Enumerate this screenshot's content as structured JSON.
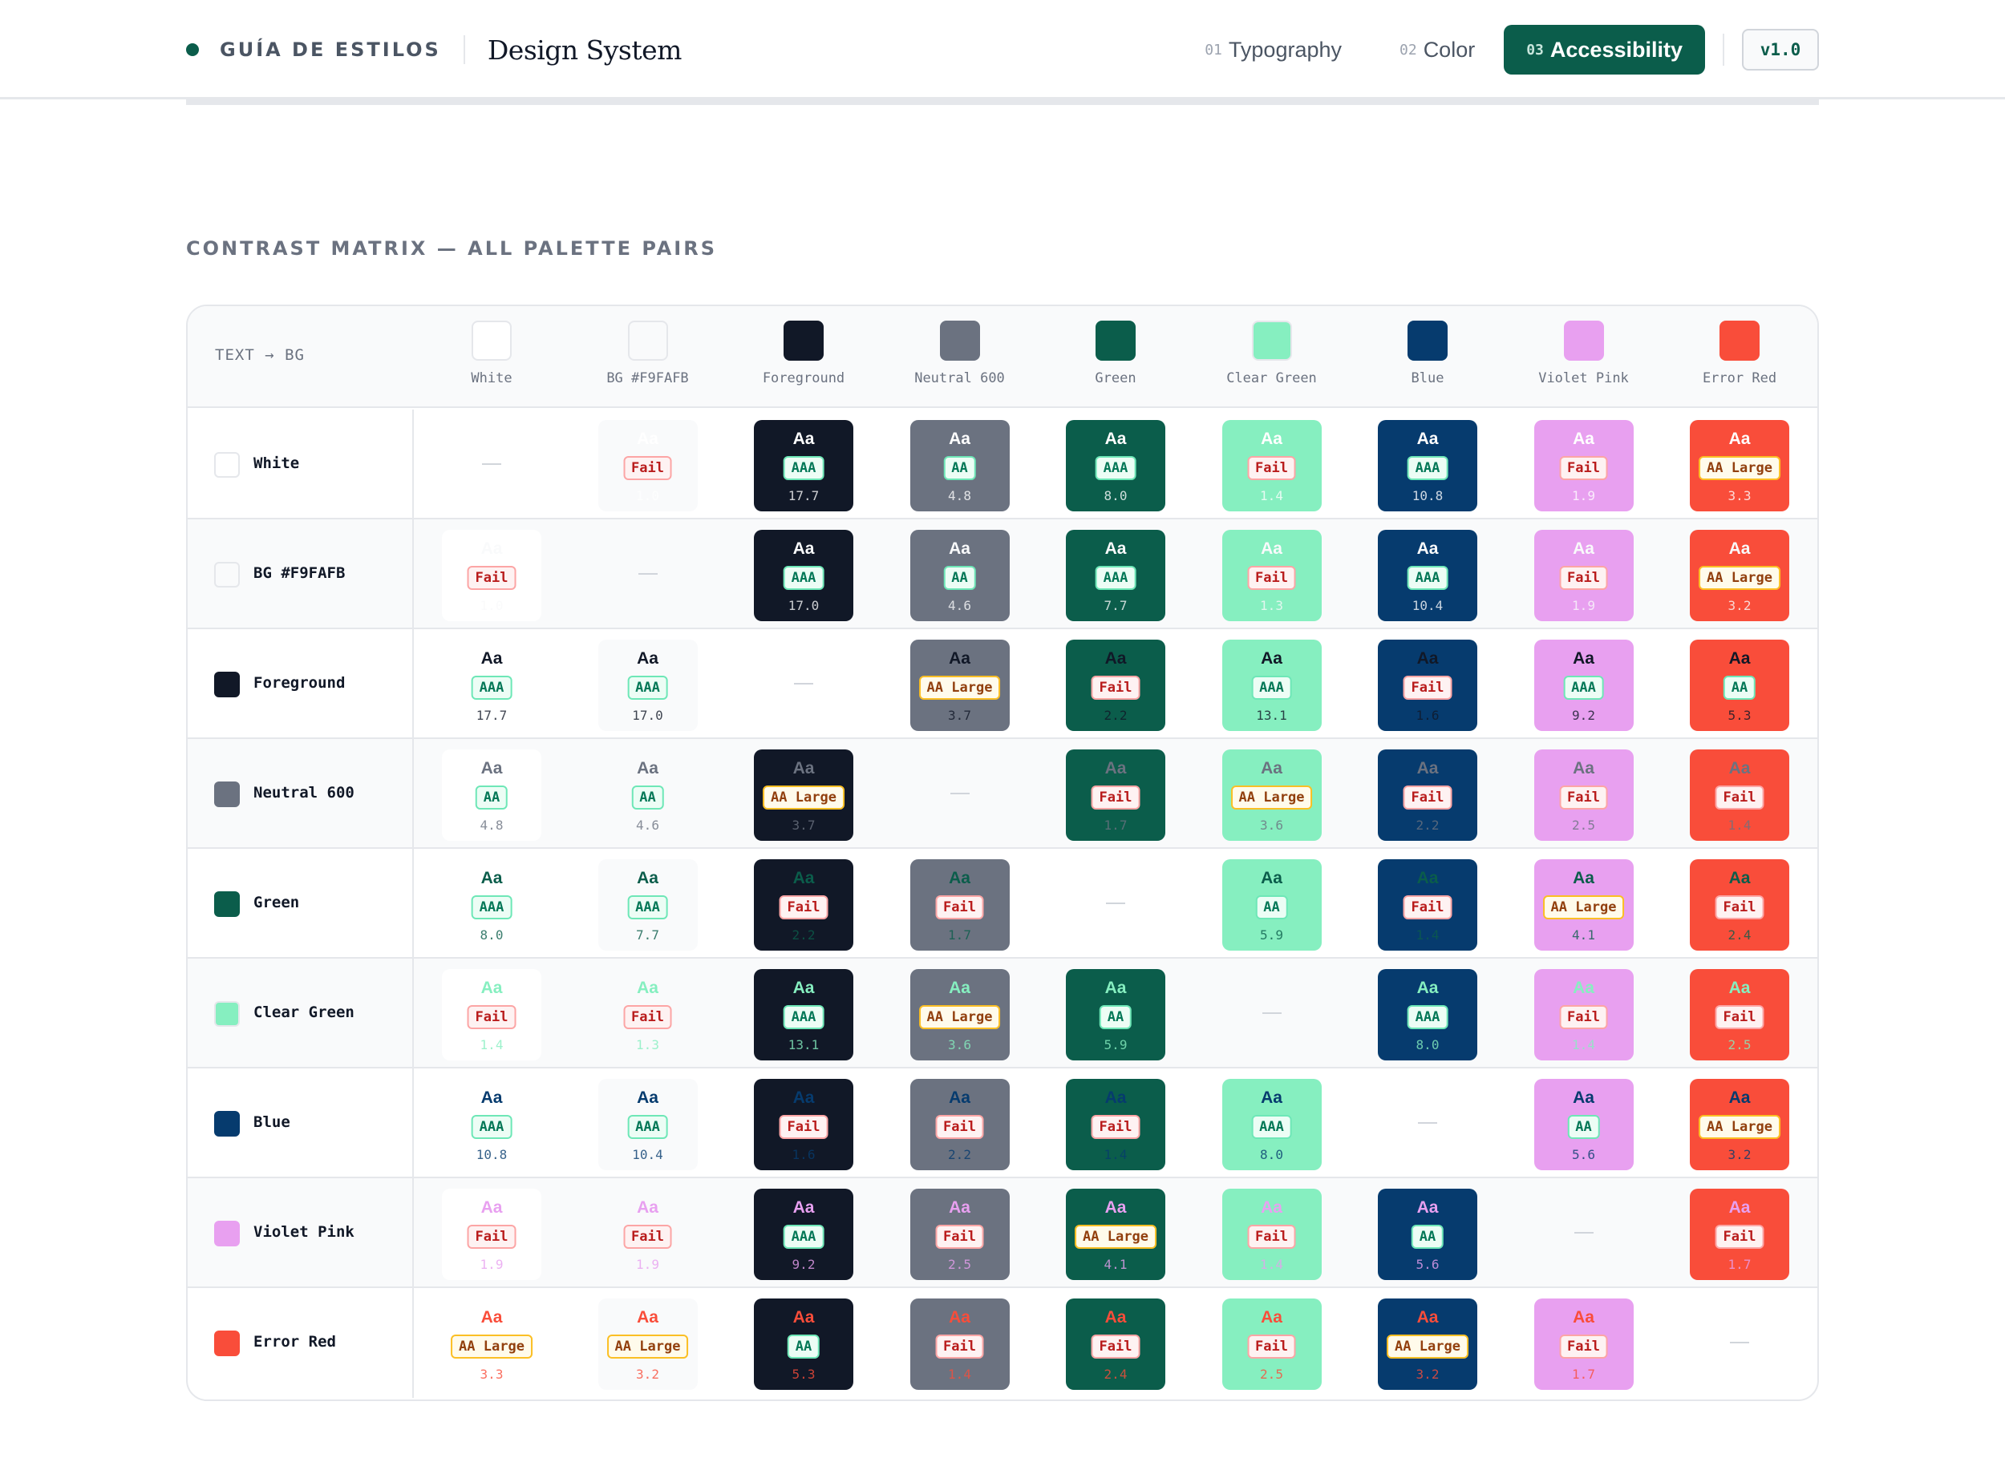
{
  "header": {
    "kicker": "GUÍA DE ESTILOS",
    "title": "Design System",
    "nav": [
      {
        "num": "01",
        "label": "Typography",
        "active": false
      },
      {
        "num": "02",
        "label": "Color",
        "active": false
      },
      {
        "num": "03",
        "label": "Accessibility",
        "active": true
      }
    ],
    "version": "v1.0"
  },
  "section_title": "CONTRAST MATRIX — ALL PALETTE PAIRS",
  "corner_label": "TEXT → BG",
  "palette": [
    {
      "name": "White",
      "hex": "#FFFFFF"
    },
    {
      "name": "BG #F9FAFB",
      "hex": "#F9FAFB"
    },
    {
      "name": "Foreground",
      "hex": "#111827"
    },
    {
      "name": "Neutral 600",
      "hex": "#6B7280"
    },
    {
      "name": "Green",
      "hex": "#0B5D4B"
    },
    {
      "name": "Clear Green",
      "hex": "#86EFC0"
    },
    {
      "name": "Blue",
      "hex": "#063B6E"
    },
    {
      "name": "Violet Pink",
      "hex": "#E8A0F0"
    },
    {
      "name": "Error Red",
      "hex": "#F94D3A"
    }
  ],
  "sample_text": "Aa",
  "empty_marker": "—",
  "matrix": [
    [
      null,
      [
        "Fail",
        "1.0"
      ],
      [
        "AAA",
        "17.7"
      ],
      [
        "AA",
        "4.8"
      ],
      [
        "AAA",
        "8.0"
      ],
      [
        "Fail",
        "1.4"
      ],
      [
        "AAA",
        "10.8"
      ],
      [
        "Fail",
        "1.9"
      ],
      [
        "AA Large",
        "3.3"
      ]
    ],
    [
      [
        "Fail",
        "1.0"
      ],
      null,
      [
        "AAA",
        "17.0"
      ],
      [
        "AA",
        "4.6"
      ],
      [
        "AAA",
        "7.7"
      ],
      [
        "Fail",
        "1.3"
      ],
      [
        "AAA",
        "10.4"
      ],
      [
        "Fail",
        "1.9"
      ],
      [
        "AA Large",
        "3.2"
      ]
    ],
    [
      [
        "AAA",
        "17.7"
      ],
      [
        "AAA",
        "17.0"
      ],
      null,
      [
        "AA Large",
        "3.7"
      ],
      [
        "Fail",
        "2.2"
      ],
      [
        "AAA",
        "13.1"
      ],
      [
        "Fail",
        "1.6"
      ],
      [
        "AAA",
        "9.2"
      ],
      [
        "AA",
        "5.3"
      ]
    ],
    [
      [
        "AA",
        "4.8"
      ],
      [
        "AA",
        "4.6"
      ],
      [
        "AA Large",
        "3.7"
      ],
      null,
      [
        "Fail",
        "1.7"
      ],
      [
        "AA Large",
        "3.6"
      ],
      [
        "Fail",
        "2.2"
      ],
      [
        "Fail",
        "2.5"
      ],
      [
        "Fail",
        "1.4"
      ]
    ],
    [
      [
        "AAA",
        "8.0"
      ],
      [
        "AAA",
        "7.7"
      ],
      [
        "Fail",
        "2.2"
      ],
      [
        "Fail",
        "1.7"
      ],
      null,
      [
        "AA",
        "5.9"
      ],
      [
        "Fail",
        "1.4"
      ],
      [
        "AA Large",
        "4.1"
      ],
      [
        "Fail",
        "2.4"
      ]
    ],
    [
      [
        "Fail",
        "1.4"
      ],
      [
        "Fail",
        "1.3"
      ],
      [
        "AAA",
        "13.1"
      ],
      [
        "AA Large",
        "3.6"
      ],
      [
        "AA",
        "5.9"
      ],
      null,
      [
        "AAA",
        "8.0"
      ],
      [
        "Fail",
        "1.4"
      ],
      [
        "Fail",
        "2.5"
      ]
    ],
    [
      [
        "AAA",
        "10.8"
      ],
      [
        "AAA",
        "10.4"
      ],
      [
        "Fail",
        "1.6"
      ],
      [
        "Fail",
        "2.2"
      ],
      [
        "Fail",
        "1.4"
      ],
      [
        "AAA",
        "8.0"
      ],
      null,
      [
        "AA",
        "5.6"
      ],
      [
        "AA Large",
        "3.2"
      ]
    ],
    [
      [
        "Fail",
        "1.9"
      ],
      [
        "Fail",
        "1.9"
      ],
      [
        "AAA",
        "9.2"
      ],
      [
        "Fail",
        "2.5"
      ],
      [
        "AA Large",
        "4.1"
      ],
      [
        "Fail",
        "1.4"
      ],
      [
        "AA",
        "5.6"
      ],
      null,
      [
        "Fail",
        "1.7"
      ]
    ],
    [
      [
        "AA Large",
        "3.3"
      ],
      [
        "AA Large",
        "3.2"
      ],
      [
        "AA",
        "5.3"
      ],
      [
        "Fail",
        "1.4"
      ],
      [
        "Fail",
        "2.4"
      ],
      [
        "Fail",
        "2.5"
      ],
      [
        "AA Large",
        "3.2"
      ],
      [
        "Fail",
        "1.7"
      ],
      null
    ]
  ]
}
